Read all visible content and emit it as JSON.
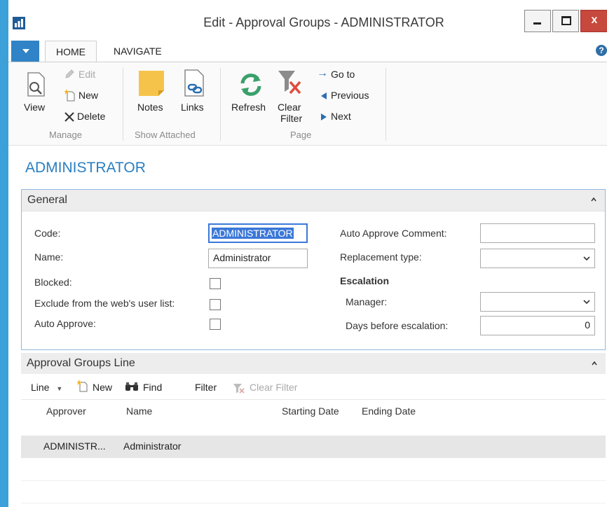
{
  "window": {
    "title": "Edit - Approval Groups - ADMINISTRATOR",
    "minimize_glyph": "—",
    "close_glyph": "x"
  },
  "tabs": {
    "home": "HOME",
    "navigate": "NAVIGATE",
    "help": "?"
  },
  "ribbon": {
    "manage": {
      "group_label": "Manage",
      "view": "View",
      "edit": "Edit",
      "new": "New",
      "delete": "Delete"
    },
    "show_attached": {
      "group_label": "Show Attached",
      "notes": "Notes",
      "links": "Links"
    },
    "page": {
      "group_label": "Page",
      "refresh": "Refresh",
      "clear_filter_1": "Clear",
      "clear_filter_2": "Filter",
      "go_to": "Go to",
      "previous": "Previous",
      "next": "Next"
    }
  },
  "page_title": "ADMINISTRATOR",
  "general": {
    "header": "General",
    "code_label": "Code:",
    "code_value": "ADMINISTRATOR",
    "name_label": "Name:",
    "name_value": "Administrator",
    "blocked_label": "Blocked:",
    "exclude_label": "Exclude from the web's user list:",
    "auto_approve_label": "Auto Approve:",
    "auto_approve_comment_label": "Auto Approve Comment:",
    "auto_approve_comment_value": "",
    "replacement_type_label": "Replacement type:",
    "replacement_type_value": "",
    "escalation_label": "Escalation",
    "manager_label": "Manager:",
    "manager_value": "",
    "days_label": "Days before escalation:",
    "days_value": "0"
  },
  "lines": {
    "header": "Approval Groups Line",
    "toolbar": {
      "line": "Line",
      "new": "New",
      "find": "Find",
      "filter": "Filter",
      "clear_filter": "Clear Filter"
    },
    "columns": {
      "approver": "Approver",
      "name": "Name",
      "starting_date": "Starting Date",
      "ending_date": "Ending Date"
    },
    "rows": [
      {
        "approver": "ADMINISTR...",
        "name": "Administrator",
        "starting_date": "",
        "ending_date": ""
      }
    ]
  },
  "colors": {
    "accent": "#2a7fc1",
    "ribbon_menu": "#2f83c6",
    "close_red": "#c7483c",
    "selection": "#3b78d8",
    "refresh_green": "#3aa06b",
    "notes_yellow": "#f6c34a"
  }
}
